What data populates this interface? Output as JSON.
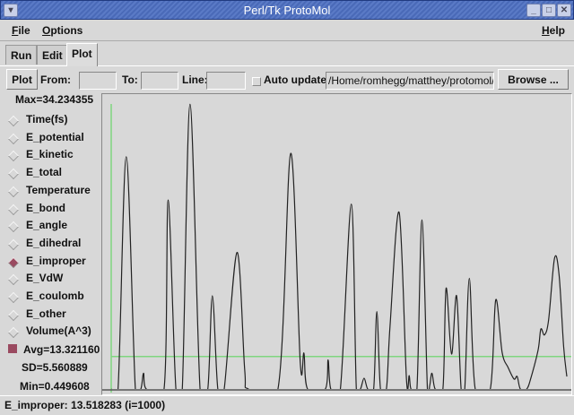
{
  "window": {
    "title": "Perl/Tk ProtoMol",
    "controls": [
      "minimize",
      "maximize",
      "close"
    ]
  },
  "menu": {
    "file": "File",
    "options": "Options",
    "help": "Help"
  },
  "tabs": [
    {
      "label": "Run"
    },
    {
      "label": "Edit"
    },
    {
      "label": "Plot",
      "active": true
    }
  ],
  "toolbar": {
    "plot_label": "Plot",
    "from_label": "From:",
    "from_value": "",
    "to_label": "To:",
    "to_value": "",
    "line_label": "Line:",
    "line_value": "",
    "auto_update_label": "Auto update",
    "auto_update_checked": false,
    "path_value": "/Home/romhegg/matthey/protomol/exa",
    "browse_label": "Browse ..."
  },
  "stats": {
    "max": "Max=34.234355",
    "avg": "Avg=13.321160",
    "sd": "SD=5.560889",
    "min": "Min=0.449608"
  },
  "series_options": [
    {
      "label": "Time(fs)",
      "selected": false
    },
    {
      "label": "E_potential",
      "selected": false
    },
    {
      "label": "E_kinetic",
      "selected": false
    },
    {
      "label": "E_total",
      "selected": false
    },
    {
      "label": "Temperature",
      "selected": false
    },
    {
      "label": "E_bond",
      "selected": false
    },
    {
      "label": "E_angle",
      "selected": false
    },
    {
      "label": "E_dihedral",
      "selected": false
    },
    {
      "label": "E_improper",
      "selected": true
    },
    {
      "label": "E_VdW",
      "selected": false
    },
    {
      "label": "E_coulomb",
      "selected": false
    },
    {
      "label": "E_other",
      "selected": false
    },
    {
      "label": "Volume(A^3)",
      "selected": false
    }
  ],
  "status": "E_improper: 13.518283 (i=1000)",
  "colors": {
    "accent": "#9a4a60",
    "line": "#222222",
    "guide": "#7fd67f",
    "titlebar": "#4a6ab8"
  },
  "chart_data": {
    "type": "line",
    "title": "",
    "xlabel": "",
    "ylabel": "",
    "grid": false,
    "xlim": [
      0,
      1000
    ],
    "ylim": [
      0,
      34.23
    ],
    "hline": 3.9,
    "vline": 0,
    "x": [
      0,
      15,
      33,
      53,
      65,
      71,
      77,
      116,
      125,
      142,
      156,
      173,
      195,
      212,
      222,
      234,
      248,
      276,
      293,
      301,
      366,
      394,
      415,
      423,
      431,
      470,
      476,
      482,
      503,
      527,
      538,
      547,
      555,
      563,
      576,
      583,
      591,
      604,
      612,
      632,
      648,
      654,
      658,
      671,
      682,
      694,
      699,
      704,
      711,
      728,
      735,
      747,
      758,
      768,
      776,
      786,
      799,
      832,
      844,
      858,
      871,
      884,
      891,
      898,
      912,
      921,
      937,
      943,
      951,
      960,
      973,
      983,
      993,
      1000
    ],
    "y": [
      0,
      0,
      27.9,
      0,
      0,
      1.9,
      0,
      0,
      22.7,
      0,
      0,
      34.2,
      0,
      0,
      11.2,
      0,
      0,
      16.4,
      2.3,
      0,
      0,
      28.3,
      3.1,
      4.3,
      0,
      0,
      3.5,
      0,
      0,
      22.2,
      0,
      0,
      1.3,
      0,
      0,
      9.3,
      0,
      0,
      7.6,
      21.2,
      1.2,
      1.6,
      0,
      0,
      20.3,
      0,
      0.4,
      1.9,
      0,
      0,
      12.1,
      4.2,
      11.2,
      0,
      0,
      13.3,
      0,
      0,
      10.7,
      4.4,
      2.6,
      1.2,
      1.5,
      0,
      0,
      1.3,
      4.7,
      7.2,
      6.5,
      8.3,
      15.7,
      13.7,
      5.1,
      1.5
    ]
  }
}
